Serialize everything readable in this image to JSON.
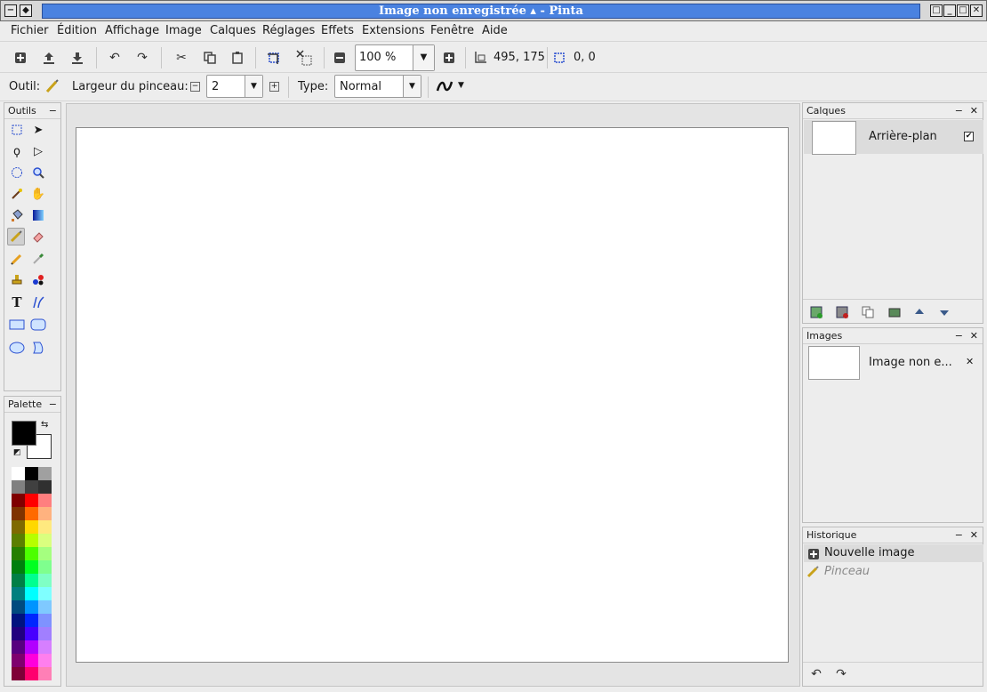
{
  "window": {
    "title": "Image non enregistrée ▴ - Pinta",
    "buttons": [
      "-",
      "◆"
    ],
    "right_buttons": [
      "□",
      "_",
      "□",
      "✕"
    ]
  },
  "menubar": [
    {
      "label": "Fichier"
    },
    {
      "label": "Édition"
    },
    {
      "label": "Affichage"
    },
    {
      "label": "Image"
    },
    {
      "label": "Calques"
    },
    {
      "label": "Réglages"
    },
    {
      "label": "Effets"
    },
    {
      "label": "Extensions"
    },
    {
      "label": "Fenêtre"
    },
    {
      "label": "Aide"
    }
  ],
  "toolbar": {
    "zoom": "100 %",
    "cursor_position": "495, 175",
    "selection_size": "0, 0"
  },
  "tool_options": {
    "tool_label": "Outil:",
    "brush_width_label": "Largeur du pinceau:",
    "brush_width": "2",
    "type_label": "Type:",
    "type_value": "Normal"
  },
  "panels": {
    "tools_title": "Outils",
    "palette_title": "Palette",
    "layers_title": "Calques",
    "images_title": "Images",
    "history_title": "Historique"
  },
  "layers": [
    {
      "name": "Arrière-plan",
      "visible": true
    }
  ],
  "images": [
    {
      "name": "Image non e..."
    }
  ],
  "history": [
    {
      "label": "Nouvelle image",
      "active": true
    },
    {
      "label": "Pinceau",
      "active": false
    }
  ],
  "palette": {
    "primary": "#000000",
    "secondary": "#ffffff",
    "swatches": [
      [
        "#ffffff",
        "#000000",
        "#a0a0a0"
      ],
      [
        "#808080",
        "#404040",
        "#303030"
      ],
      [
        "#7f0000",
        "#ff0000",
        "#ff7f7f"
      ],
      [
        "#7f3300",
        "#ff6a00",
        "#ffb27f"
      ],
      [
        "#7f6a00",
        "#ffd800",
        "#ffe97f"
      ],
      [
        "#5b7f00",
        "#b6ff00",
        "#daff7f"
      ],
      [
        "#267f00",
        "#4cff00",
        "#a5ff7f"
      ],
      [
        "#007f0e",
        "#00ff21",
        "#7fff8e"
      ],
      [
        "#007f46",
        "#00ff90",
        "#7fffc5"
      ],
      [
        "#007f7f",
        "#00ffff",
        "#7fffff"
      ],
      [
        "#004a7f",
        "#0094ff",
        "#7fc9ff"
      ],
      [
        "#00137f",
        "#0026ff",
        "#7f92ff"
      ],
      [
        "#21007f",
        "#4800ff",
        "#a17fff"
      ],
      [
        "#57007f",
        "#b200ff",
        "#d67fff"
      ],
      [
        "#7f006e",
        "#ff00dc",
        "#ff7fed"
      ],
      [
        "#7f0037",
        "#ff006e",
        "#ff7fb6"
      ]
    ]
  }
}
